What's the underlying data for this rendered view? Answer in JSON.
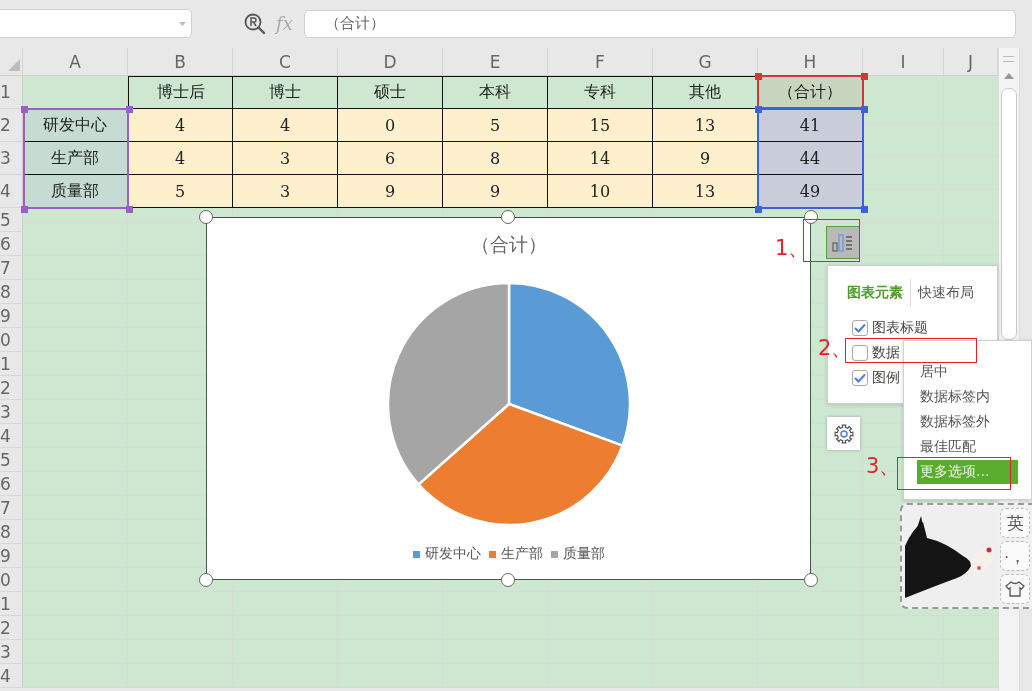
{
  "formula_bar": {
    "fx_label": "fx",
    "formula": "（合计）"
  },
  "sheet": {
    "columns": [
      "A",
      "B",
      "C",
      "D",
      "E",
      "F",
      "G",
      "H",
      "I",
      "J"
    ],
    "row_numbers": [
      "1",
      "2",
      "3",
      "4",
      "5",
      "6",
      "7",
      "8",
      "9",
      "0",
      "1",
      "2",
      "3",
      "4",
      "5",
      "6",
      "7",
      "8",
      "9",
      "0",
      "1",
      "2",
      "3",
      "4"
    ],
    "rows": [
      [
        "",
        "博士后",
        "博士",
        "硕士",
        "本科",
        "专科",
        "其他",
        "（合计）"
      ],
      [
        "研发中心",
        "4",
        "4",
        "0",
        "5",
        "15",
        "13",
        "41"
      ],
      [
        "生产部",
        "4",
        "3",
        "6",
        "8",
        "14",
        "9",
        "44"
      ],
      [
        "质量部",
        "5",
        "3",
        "9",
        "9",
        "10",
        "13",
        "49"
      ]
    ],
    "reference_ranges": [
      {
        "color": "#9b5fc8"
      },
      {
        "color": "#d0393b"
      },
      {
        "color": "#3a63d6"
      }
    ]
  },
  "chart": {
    "title": "（合计）",
    "legend": [
      {
        "label": "研发中心",
        "color": "#5b9bd5"
      },
      {
        "label": "生产部",
        "color": "#ed7d31"
      },
      {
        "label": "质量部",
        "color": "#a5a5a5"
      }
    ]
  },
  "chart_tools": {
    "tabs": [
      {
        "label": "图表元素",
        "selected": true
      },
      {
        "label": "快速布局",
        "selected": false
      }
    ],
    "elements": [
      {
        "label": "图表标题",
        "checked": true
      },
      {
        "label": "数据",
        "checked": false
      },
      {
        "label": "图例",
        "checked": true
      }
    ],
    "label_positions": [
      {
        "label": "居中",
        "selected": false
      },
      {
        "label": "数据标签内",
        "selected": false
      },
      {
        "label": "数据标签外",
        "selected": false
      },
      {
        "label": "最佳匹配",
        "selected": false
      },
      {
        "label": "更多选项...",
        "selected": true
      }
    ],
    "callouts": [
      "1、",
      "2、",
      "3、"
    ]
  },
  "ime": {
    "keys": [
      "英",
      "·，"
    ]
  }
}
